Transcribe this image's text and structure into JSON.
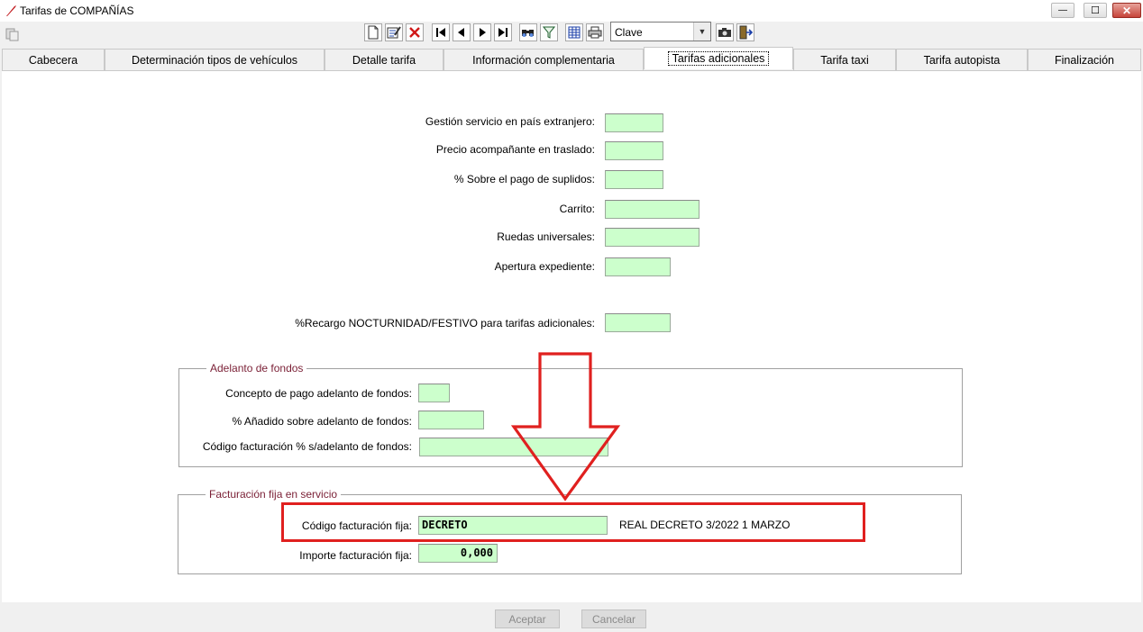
{
  "window": {
    "title": "Tarifas de COMPAÑÍAS",
    "controls": {
      "minimize": "—",
      "maximize": "☐",
      "close": "✕"
    }
  },
  "toolbar": {
    "order_select": {
      "value": "Clave"
    },
    "icons": [
      "side-menu-icon",
      "new-record-icon",
      "edit-record-icon",
      "delete-record-icon",
      "first-record-icon",
      "previous-record-icon",
      "next-record-icon",
      "last-record-icon",
      "search-icon",
      "filter-icon",
      "grid-view-icon",
      "print-icon",
      "camera-icon",
      "exit-icon"
    ]
  },
  "tabs": [
    {
      "label": "Cabecera"
    },
    {
      "label": "Determinación tipos de vehículos"
    },
    {
      "label": "Detalle tarifa"
    },
    {
      "label": "Información complementaria"
    },
    {
      "label": "Tarifas adicionales",
      "active": true
    },
    {
      "label": "Tarifa taxi"
    },
    {
      "label": "Tarifa autopista"
    },
    {
      "label": "Finalización"
    }
  ],
  "form": {
    "gestion_label": "Gestión servicio en país extranjero:",
    "gestion_value": "",
    "acompanante_label": "Precio acompañante en traslado:",
    "acompanante_value": "",
    "suplidos_label": "% Sobre el pago de suplidos:",
    "suplidos_value": "",
    "carrito_label": "Carrito:",
    "carrito_value": "",
    "ruedas_label": "Ruedas universales:",
    "ruedas_value": "",
    "apertura_label": "Apertura expediente:",
    "apertura_value": "",
    "recargo_label": "%Recargo NOCTURNIDAD/FESTIVO para tarifas adicionales:",
    "recargo_value": ""
  },
  "adelanto": {
    "legend": "Adelanto de fondos",
    "concepto_label": "Concepto de pago adelanto de fondos:",
    "concepto_value": "",
    "anadido_label": "% Añadido sobre adelanto de fondos:",
    "anadido_value": "",
    "codigo_label": "Código facturación % s/adelanto de fondos:",
    "codigo_value": ""
  },
  "facturacion": {
    "legend": "Facturación fija en servicio",
    "codigo_label": "Código facturación fija:",
    "codigo_value": "DECRETO",
    "codigo_description": "REAL DECRETO 3/2022 1 MARZO",
    "importe_label": "Importe facturación fija:",
    "importe_value": "0,000"
  },
  "buttons": {
    "accept": "Aceptar",
    "cancel": "Cancelar"
  },
  "colors": {
    "field_bg": "#ccffcc",
    "annotation_red": "#e0201f",
    "legend_text": "#7a1f35"
  }
}
